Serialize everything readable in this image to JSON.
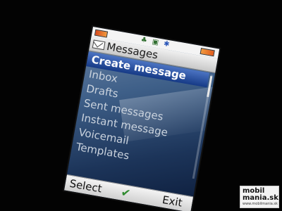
{
  "status": {
    "signal_icon": "signal-antenna-icon",
    "network_icon": "gprs-icon",
    "bluetooth_icon": "bluetooth-icon",
    "battery_left_color": "#d64a1e",
    "battery_right_color": "#e05a1c"
  },
  "header": {
    "title": "Messages",
    "icon": "envelope-icon"
  },
  "menu": {
    "items": [
      {
        "label": "Create message",
        "selected": true
      },
      {
        "label": "Inbox",
        "selected": false
      },
      {
        "label": "Drafts",
        "selected": false
      },
      {
        "label": "Sent messages",
        "selected": false
      },
      {
        "label": "Instant message",
        "selected": false
      },
      {
        "label": "Voicemail",
        "selected": false
      },
      {
        "label": "Templates",
        "selected": false
      }
    ]
  },
  "softkeys": {
    "left": "Select",
    "center_icon": "checkmark-icon",
    "right": "Exit"
  },
  "colors": {
    "selection": "#1e4798",
    "screen_bg": "#3e5f88",
    "menu_text": "#c9d2dd"
  },
  "watermark": {
    "line1": "mobil",
    "line2": "mania.sk",
    "line3": "www.mobilmania.sk"
  }
}
